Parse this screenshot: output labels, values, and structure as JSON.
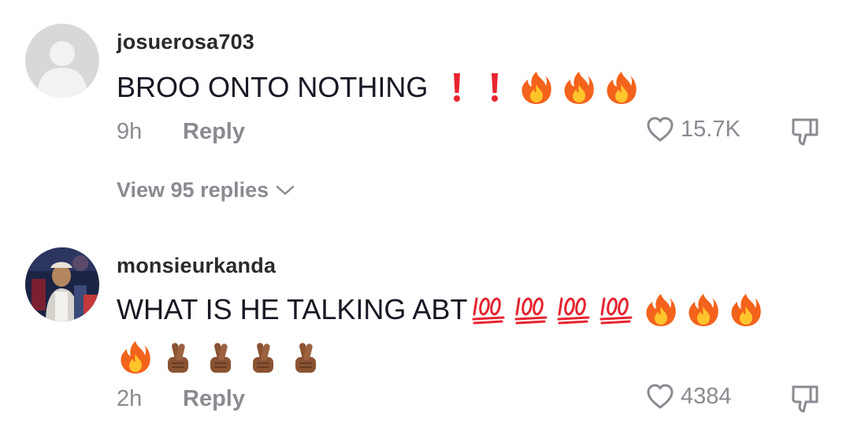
{
  "comments": [
    {
      "username": "josuerosa703",
      "text": "BROO ONTO NOTHING",
      "emojis_line1": [
        "exclamation",
        "exclamation",
        "fire",
        "fire",
        "fire"
      ],
      "time": "9h",
      "reply_label": "Reply",
      "likes": "15.7K",
      "avatar": "default-avatar",
      "view_replies": "View 95 replies"
    },
    {
      "username": "monsieurkanda",
      "text": "WHAT IS HE TALKING ABT",
      "emojis_line1": [
        "hundred",
        "hundred",
        "hundred",
        "hundred",
        "fire",
        "fire",
        "fire"
      ],
      "emojis_line2": [
        "fire",
        "crossed-fingers",
        "crossed-fingers",
        "crossed-fingers",
        "crossed-fingers"
      ],
      "time": "2h",
      "reply_label": "Reply",
      "likes": "4384",
      "avatar": "photo-avatar"
    }
  ],
  "colors": {
    "text": "#161823",
    "muted": "#8a8b91",
    "exclamation": "#e8242f",
    "fire_outer": "#f4631c",
    "fire_inner": "#ffc52b",
    "hundred": "#e52430",
    "skin": "#8a5332"
  },
  "icons": {
    "like": "heart-outline-icon",
    "dislike": "thumbs-down-icon",
    "expand": "chevron-down-icon"
  }
}
